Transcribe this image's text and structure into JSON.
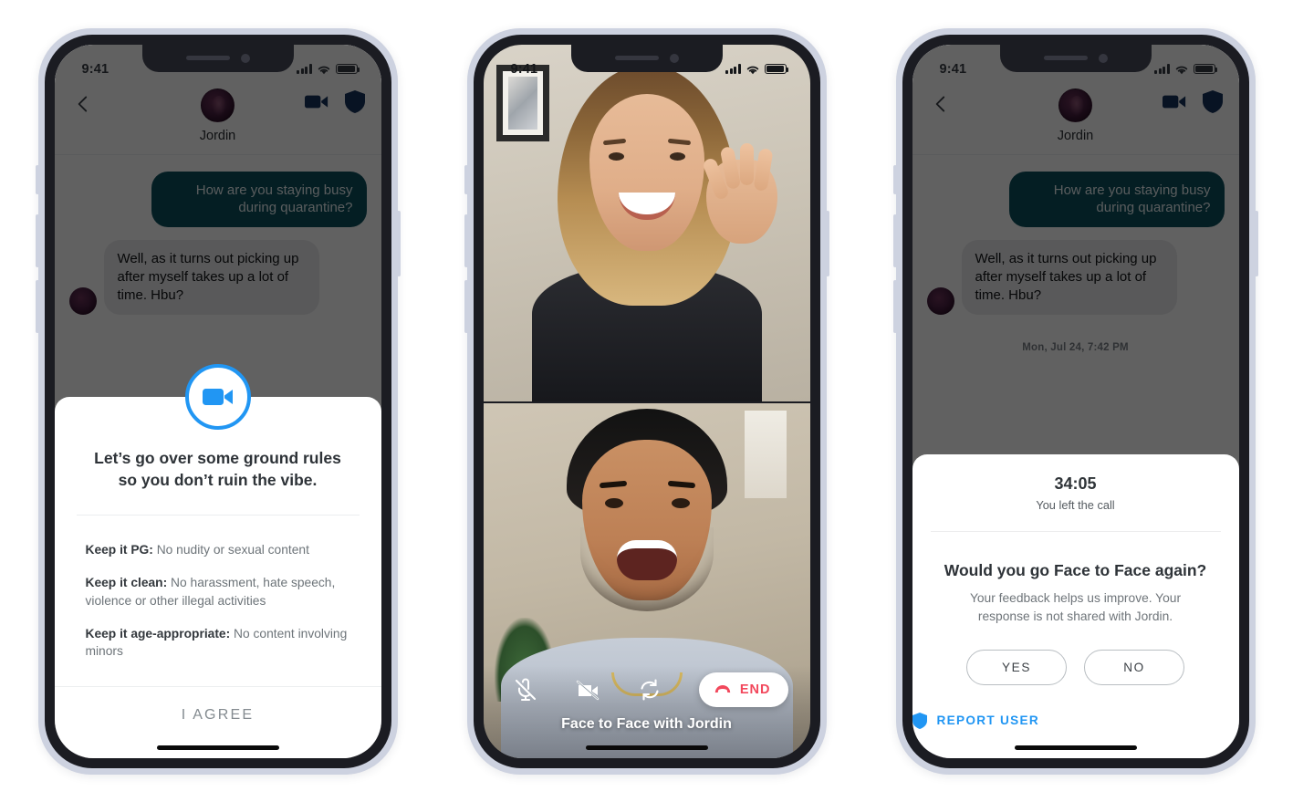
{
  "phones": [
    {
      "id": "ground-rules",
      "status_bar": {
        "time": "9:41",
        "signal_icon": "cellular-bars-icon",
        "wifi_icon": "wifi-icon",
        "battery_icon": "battery-full-icon"
      },
      "chat": {
        "back_icon": "chevron-left-icon",
        "avatar_icon": "user-avatar",
        "name": "Jordin",
        "video_icon": "video-camera-icon",
        "shield_icon": "shield-icon",
        "messages": [
          {
            "direction": "out",
            "text": "How are you staying busy during quarantine?"
          },
          {
            "direction": "in",
            "text": "Well, as it turns out picking up after myself takes up a lot of time. Hbu?"
          }
        ]
      },
      "sheet": {
        "badge_icon": "video-camera-icon",
        "title": "Let’s go over some ground rules so you don’t ruin the vibe.",
        "rules": [
          {
            "bold": "Keep it PG:",
            "text": " No nudity or sexual content"
          },
          {
            "bold": "Keep it clean:",
            "text": " No harassment, hate speech, violence or other illegal activities"
          },
          {
            "bold": "Keep it age-appropriate:",
            "text": " No content involving minors"
          }
        ],
        "agree_label": "I AGREE"
      }
    },
    {
      "id": "active-call",
      "status_bar": {
        "time": "9:41",
        "signal_icon": "cellular-bars-icon",
        "wifi_icon": "wifi-icon",
        "battery_icon": "battery-full-icon"
      },
      "call": {
        "controls": [
          {
            "name": "mic-off-icon",
            "label": "Mute"
          },
          {
            "name": "video-off-icon",
            "label": "Stop video"
          },
          {
            "name": "flip-camera-icon",
            "label": "Flip camera"
          }
        ],
        "end_label": "END",
        "end_icon": "phone-hangup-icon",
        "caption": "Face to Face with Jordin"
      }
    },
    {
      "id": "post-call-feedback",
      "status_bar": {
        "time": "9:41",
        "signal_icon": "cellular-bars-icon",
        "wifi_icon": "wifi-icon",
        "battery_icon": "battery-full-icon"
      },
      "chat": {
        "back_icon": "chevron-left-icon",
        "avatar_icon": "user-avatar",
        "name": "Jordin",
        "video_icon": "video-camera-icon",
        "shield_icon": "shield-icon",
        "messages": [
          {
            "direction": "out",
            "text": "How are you staying busy during quarantine?"
          },
          {
            "direction": "in",
            "text": "Well, as it turns out picking up after myself takes up a lot of time. Hbu?"
          }
        ],
        "timestamp": "Mon, Jul 24, 7:42 PM"
      },
      "feedback": {
        "duration": "34:05",
        "duration_sub": "You left the call",
        "question": "Would you go Face to Face again?",
        "description": "Your feedback helps us improve. Your response is not shared with Jordin.",
        "yes_label": "YES",
        "no_label": "NO",
        "report_label": "REPORT USER",
        "report_icon": "shield-icon"
      }
    }
  ],
  "colors": {
    "accent_blue": "#2196f3",
    "bubble_out": "#0b4f5e",
    "bubble_in": "#e9eaec",
    "shield_navy": "#16325c",
    "end_red": "#f2485c",
    "bezel": "#cdd2e0",
    "frame": "#1b1c22"
  }
}
